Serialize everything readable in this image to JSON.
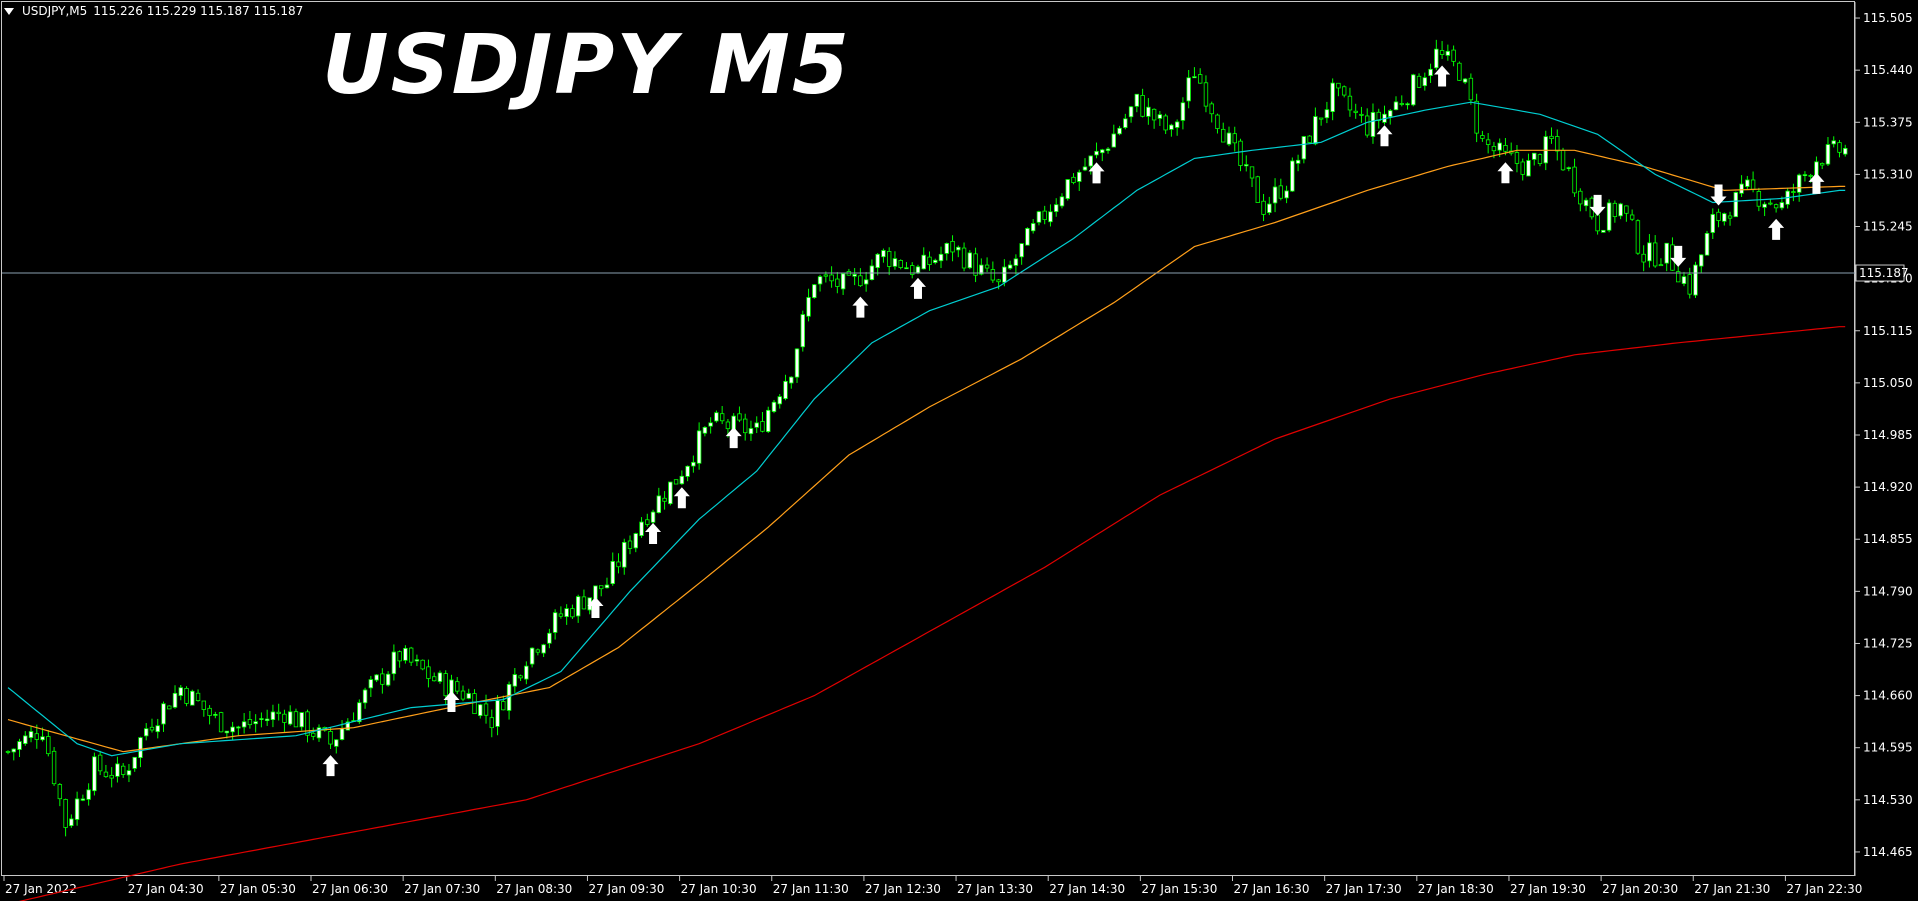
{
  "header": {
    "symbol_tf": "USDJPY,M5",
    "ohlc": "115.226 115.229 115.187 115.187"
  },
  "watermark": "USDJPY M5",
  "current_price": "115.187",
  "colors": {
    "background": "#000000",
    "bull_candle": "#00ff00",
    "bull_body": "#ffffff",
    "bear_body": "#000000",
    "ma_fast": "#00ced1",
    "ma_mid": "#ff9f1a",
    "ma_slow": "#e00000",
    "arrow": "#ffffff",
    "grid_text": "#ffffff",
    "price_line": "#8aa0b0"
  },
  "chart_data": {
    "type": "candlestick",
    "y_axis": {
      "ticks": [
        "115.505",
        "115.440",
        "115.375",
        "115.310",
        "115.245",
        "115.180",
        "115.115",
        "115.050",
        "114.985",
        "114.920",
        "114.855",
        "114.790",
        "114.725",
        "114.660",
        "114.595",
        "114.530",
        "114.465"
      ],
      "min": 114.435,
      "max": 115.525
    },
    "x_axis": {
      "ticks": [
        "27 Jan 2022",
        "27 Jan 04:30",
        "27 Jan 05:30",
        "27 Jan 06:30",
        "27 Jan 07:30",
        "27 Jan 08:30",
        "27 Jan 09:30",
        "27 Jan 10:30",
        "27 Jan 11:30",
        "27 Jan 12:30",
        "27 Jan 13:30",
        "27 Jan 14:30",
        "27 Jan 15:30",
        "27 Jan 16:30",
        "27 Jan 17:30",
        "27 Jan 18:30",
        "27 Jan 19:30",
        "27 Jan 20:30",
        "27 Jan 21:30",
        "27 Jan 22:30"
      ]
    },
    "price_anchors": [
      [
        0,
        114.59
      ],
      [
        6,
        114.62
      ],
      [
        10,
        114.5
      ],
      [
        15,
        114.57
      ],
      [
        20,
        114.56
      ],
      [
        24,
        114.62
      ],
      [
        30,
        114.67
      ],
      [
        36,
        114.63
      ],
      [
        40,
        114.62
      ],
      [
        48,
        114.64
      ],
      [
        56,
        114.6
      ],
      [
        62,
        114.66
      ],
      [
        68,
        114.71
      ],
      [
        74,
        114.68
      ],
      [
        80,
        114.66
      ],
      [
        84,
        114.63
      ],
      [
        90,
        114.71
      ],
      [
        96,
        114.76
      ],
      [
        104,
        114.8
      ],
      [
        110,
        114.88
      ],
      [
        116,
        114.93
      ],
      [
        122,
        115.0
      ],
      [
        130,
        114.99
      ],
      [
        136,
        115.07
      ],
      [
        140,
        115.18
      ],
      [
        146,
        115.17
      ],
      [
        152,
        115.21
      ],
      [
        158,
        115.19
      ],
      [
        164,
        115.22
      ],
      [
        172,
        115.17
      ],
      [
        178,
        115.24
      ],
      [
        184,
        115.3
      ],
      [
        190,
        115.34
      ],
      [
        196,
        115.4
      ],
      [
        202,
        115.36
      ],
      [
        206,
        115.44
      ],
      [
        210,
        115.38
      ],
      [
        214,
        115.32
      ],
      [
        218,
        115.27
      ],
      [
        222,
        115.3
      ],
      [
        226,
        115.36
      ],
      [
        230,
        115.41
      ],
      [
        236,
        115.37
      ],
      [
        240,
        115.39
      ],
      [
        244,
        115.42
      ],
      [
        248,
        115.46
      ],
      [
        252,
        115.44
      ],
      [
        256,
        115.35
      ],
      [
        260,
        115.33
      ],
      [
        264,
        115.32
      ],
      [
        268,
        115.35
      ],
      [
        272,
        115.3
      ],
      [
        276,
        115.25
      ],
      [
        280,
        115.27
      ],
      [
        284,
        115.21
      ],
      [
        288,
        115.21
      ],
      [
        292,
        115.17
      ],
      [
        296,
        115.25
      ],
      [
        302,
        115.29
      ],
      [
        308,
        115.27
      ],
      [
        314,
        115.33
      ],
      [
        318,
        115.34
      ]
    ],
    "ma_fast_anchors": [
      [
        0,
        114.67
      ],
      [
        12,
        114.6
      ],
      [
        18,
        114.585
      ],
      [
        30,
        114.6
      ],
      [
        50,
        114.61
      ],
      [
        70,
        114.645
      ],
      [
        86,
        114.655
      ],
      [
        96,
        114.69
      ],
      [
        108,
        114.79
      ],
      [
        120,
        114.88
      ],
      [
        130,
        114.94
      ],
      [
        140,
        115.03
      ],
      [
        150,
        115.1
      ],
      [
        160,
        115.14
      ],
      [
        172,
        115.17
      ],
      [
        185,
        115.23
      ],
      [
        196,
        115.29
      ],
      [
        206,
        115.33
      ],
      [
        216,
        115.34
      ],
      [
        228,
        115.35
      ],
      [
        236,
        115.375
      ],
      [
        246,
        115.39
      ],
      [
        254,
        115.4
      ],
      [
        266,
        115.385
      ],
      [
        276,
        115.36
      ],
      [
        286,
        115.31
      ],
      [
        296,
        115.275
      ],
      [
        308,
        115.28
      ],
      [
        318,
        115.29
      ]
    ],
    "ma_mid_anchors": [
      [
        0,
        114.63
      ],
      [
        20,
        114.59
      ],
      [
        40,
        114.61
      ],
      [
        60,
        114.62
      ],
      [
        80,
        114.65
      ],
      [
        94,
        114.67
      ],
      [
        106,
        114.72
      ],
      [
        120,
        114.8
      ],
      [
        132,
        114.87
      ],
      [
        146,
        114.96
      ],
      [
        160,
        115.02
      ],
      [
        176,
        115.08
      ],
      [
        192,
        115.15
      ],
      [
        206,
        115.22
      ],
      [
        220,
        115.25
      ],
      [
        236,
        115.29
      ],
      [
        250,
        115.32
      ],
      [
        262,
        115.34
      ],
      [
        272,
        115.34
      ],
      [
        284,
        115.32
      ],
      [
        298,
        115.29
      ],
      [
        318,
        115.295
      ]
    ],
    "ma_slow_anchors": [
      [
        0,
        114.4
      ],
      [
        30,
        114.45
      ],
      [
        60,
        114.49
      ],
      [
        90,
        114.53
      ],
      [
        120,
        114.6
      ],
      [
        140,
        114.66
      ],
      [
        160,
        114.74
      ],
      [
        180,
        114.82
      ],
      [
        200,
        114.91
      ],
      [
        220,
        114.98
      ],
      [
        240,
        115.03
      ],
      [
        256,
        115.06
      ],
      [
        272,
        115.085
      ],
      [
        290,
        115.1
      ],
      [
        304,
        115.11
      ],
      [
        318,
        115.12
      ]
    ],
    "up_arrows": [
      56,
      77,
      102,
      112,
      117,
      126,
      148,
      158,
      189,
      239,
      249,
      260,
      307,
      314
    ],
    "down_arrows": [
      276,
      290,
      297
    ]
  }
}
